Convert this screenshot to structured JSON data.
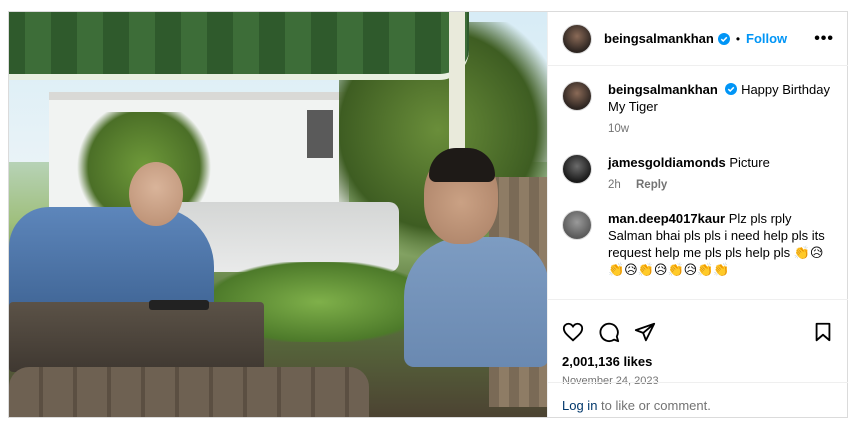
{
  "post": {
    "username": "beingsalmankhan",
    "follow_label": "Follow",
    "dot": "•",
    "more_label": "•••",
    "caption": "Happy Birthday My Tiger",
    "caption_time": "10w"
  },
  "comments": [
    {
      "username": "jamesgoldiamonds",
      "text": "Picture",
      "time": "2h",
      "reply_label": "Reply"
    },
    {
      "username": "man.deep4017kaur",
      "text": "Plz pls rply Salman bhai pls pls i need help pls its request help me pls pls help pls 👏😥👏😥👏😥👏😥👏👏"
    }
  ],
  "actions": {
    "likes": "2,001,136 likes",
    "date": "November 24, 2023"
  },
  "login": {
    "link": "Log in",
    "rest": " to like or comment."
  },
  "colors": {
    "accent": "#0095f6",
    "verified": "#0095f6",
    "secondary_text": "#737373"
  }
}
